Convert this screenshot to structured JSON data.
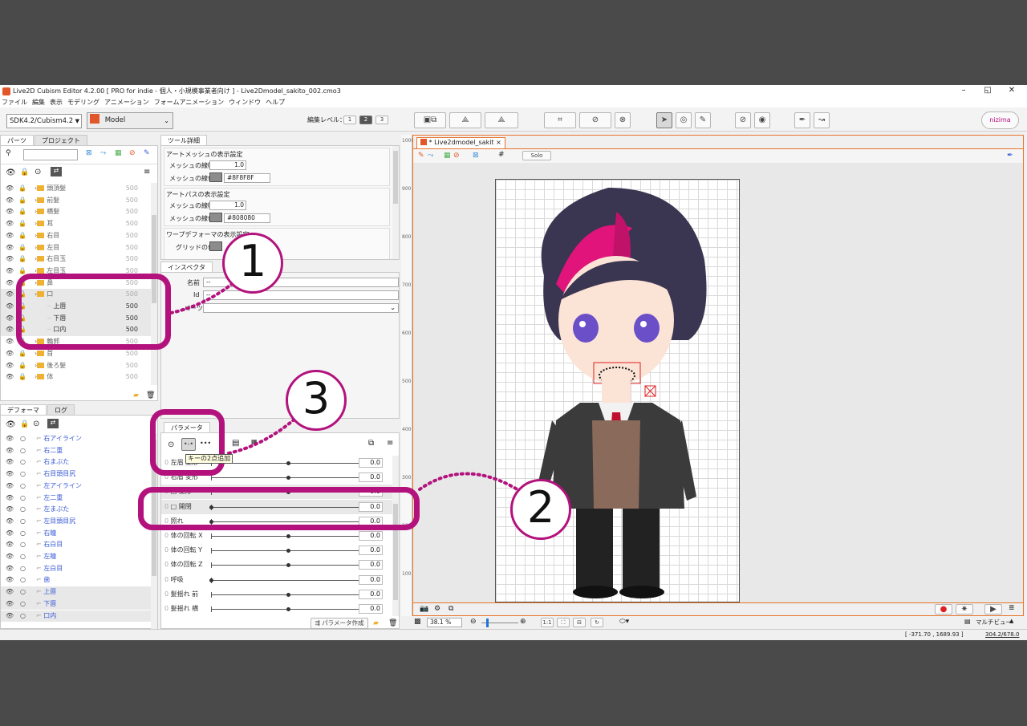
{
  "app": {
    "title": "Live2D Cubism Editor 4.2.00 [ PRO for indie - 個人・小規模事業者向け ] - Live2Dmodel_sakito_002.cmo3",
    "min_glyph": "–",
    "max_glyph": "◱",
    "close_glyph": "✕"
  },
  "menu": [
    "ファイル",
    "編集",
    "表示",
    "モデリング",
    "アニメーション",
    "フォームアニメーション",
    "ウィンドウ",
    "ヘルプ"
  ],
  "toolbar": {
    "sdk_select": "SDK4.2/Cubism4.2",
    "mode_select": "Model",
    "edit_level_label": "編集レベル：",
    "levels": [
      "1",
      "2",
      "3"
    ],
    "nizima_label": "nizima"
  },
  "parts_panel": {
    "tabs": [
      "パーツ",
      "プロジェクト"
    ],
    "rows": [
      {
        "name": "頭頂髪",
        "value": "500"
      },
      {
        "name": "前髪",
        "value": "500"
      },
      {
        "name": "横髪",
        "value": "500"
      },
      {
        "name": "耳",
        "value": "500"
      },
      {
        "name": "右目",
        "value": "500"
      },
      {
        "name": "左目",
        "value": "500"
      },
      {
        "name": "右目玉",
        "value": "500"
      },
      {
        "name": "左目玉",
        "value": "500"
      },
      {
        "name": "鼻",
        "value": "500"
      },
      {
        "name": "口",
        "value": "500"
      },
      {
        "name": "上唇",
        "value": "500"
      },
      {
        "name": "下唇",
        "value": "500"
      },
      {
        "name": "口内",
        "value": "500"
      },
      {
        "name": "輪郭",
        "value": "500"
      },
      {
        "name": "首",
        "value": "500"
      },
      {
        "name": "後ろ髪",
        "value": "500"
      },
      {
        "name": "体",
        "value": "500"
      }
    ]
  },
  "tool_detail": {
    "tab": "ツール詳細",
    "sections": [
      {
        "title": "アートメッシュの表示設定",
        "width_label": "メッシュの線幅",
        "width_value": "1.0",
        "color_label": "メッシュの線色",
        "color_value": "#8F8F8F"
      },
      {
        "title": "アートパスの表示設定",
        "width_label": "メッシュの線幅",
        "width_value": "1.0",
        "color_label": "メッシュの線色",
        "color_value": "#808080"
      }
    ],
    "warp_title": "ワープデフォーマの表示設定",
    "grid_color_label": "グリッドの色"
  },
  "inspector": {
    "tab": "インスペクタ",
    "name_label": "名前",
    "name_value": "--",
    "id_label": "Id",
    "id_value": "--",
    "part_label": "パーツ"
  },
  "deformer_panel": {
    "tabs": [
      "デフォーマ",
      "ログ"
    ],
    "rows": [
      "右アイライン",
      "右二重",
      "右まぶた",
      "右目頭目尻",
      "左アイライン",
      "左二重",
      "左まぶた",
      "左目頭目尻",
      "右瞳",
      "右白目",
      "左瞳",
      "左白目",
      "歯",
      "上唇",
      "下唇",
      "口内"
    ]
  },
  "param_panel": {
    "tab": "パラメータ",
    "tooltip": "キーの2点追加",
    "rows": [
      {
        "label": "左眉 変形",
        "value": "0.0",
        "knob": 0.5
      },
      {
        "label": "右眉 変形",
        "value": "0.0",
        "knob": 0.5
      },
      {
        "label": "□ 変形",
        "value": "0.0",
        "knob": 0.5
      },
      {
        "label": "□ 開閉",
        "value": "0.0",
        "knob": 0.0
      },
      {
        "label": "照れ",
        "value": "0.0",
        "knob": 0.0
      },
      {
        "label": "体の回転 X",
        "value": "0.0",
        "knob": 0.5
      },
      {
        "label": "体の回転 Y",
        "value": "0.0",
        "knob": 0.5
      },
      {
        "label": "体の回転 Z",
        "value": "0.0",
        "knob": 0.5
      },
      {
        "label": "呼吸",
        "value": "0.0",
        "knob": 0.0
      },
      {
        "label": "髪揺れ 前",
        "value": "0.0",
        "knob": 0.5
      },
      {
        "label": "髪揺れ 横",
        "value": "0.0",
        "knob": 0.5
      }
    ],
    "create_button": "パラメータ作成"
  },
  "canvas": {
    "tab": "* Live2dmodel_sakit",
    "solo": "Solo",
    "ruler": [
      "1000",
      "900",
      "800",
      "700",
      "600",
      "500",
      "400",
      "300",
      "200",
      "100"
    ],
    "zoom": "38.1 %",
    "view_label": "マルチビュー"
  },
  "status": {
    "coords": "[ -371.70 , 1689.93 ]",
    "size": "304.2/678.0"
  },
  "callouts": [
    "1",
    "2",
    "3"
  ],
  "colors": {
    "accent": "#b3127d",
    "canvas_border": "#e8742a",
    "deformer_text": "#3b5bd6"
  }
}
